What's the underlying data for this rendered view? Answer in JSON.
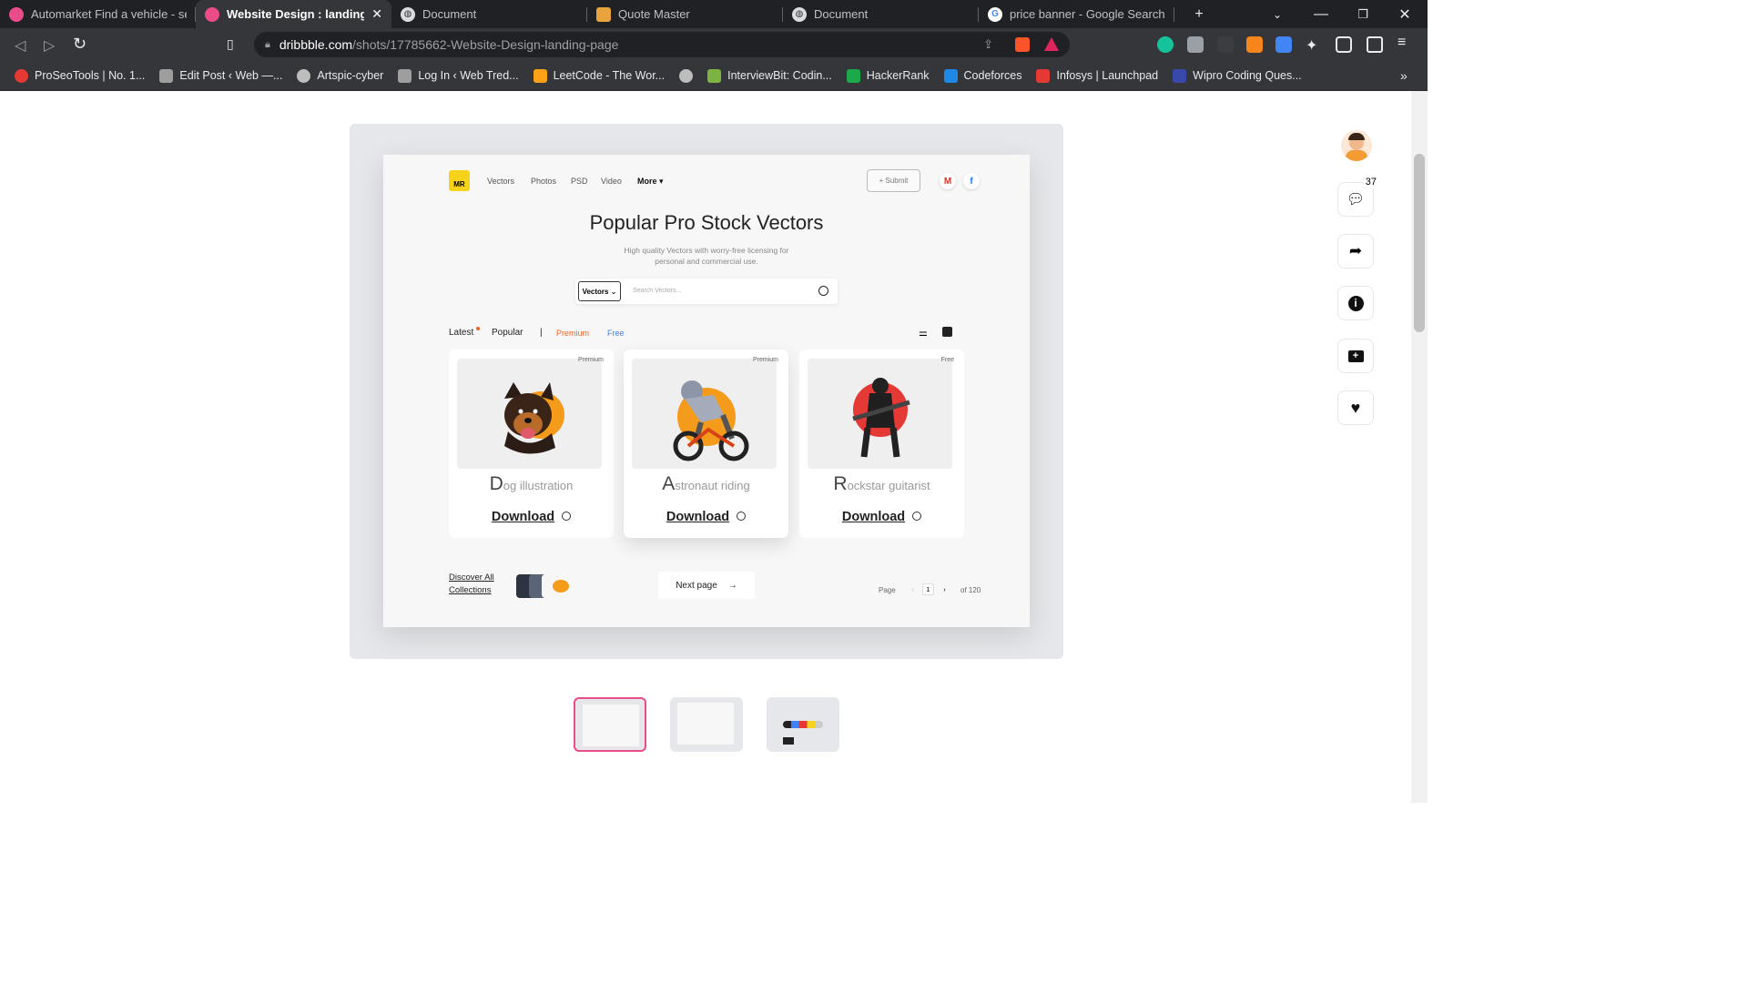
{
  "tabs": [
    {
      "title": "Automarket Find a vehicle - search",
      "favicon": "dribbble-icon",
      "color": "#ea4c89"
    },
    {
      "title": "Website Design : landing page",
      "favicon": "dribbble-icon",
      "color": "#ea4c89",
      "active": true
    },
    {
      "title": "Document",
      "favicon": "globe-icon",
      "color": "#9aa0a6"
    },
    {
      "title": "Quote Master",
      "favicon": "burger-icon",
      "color": "#e8a33d"
    },
    {
      "title": "Document",
      "favicon": "globe-icon",
      "color": "#9aa0a6"
    },
    {
      "title": "price banner - Google Search",
      "favicon": "google-icon",
      "color": "#4285f4"
    }
  ],
  "address": {
    "host": "dribbble.com",
    "path": "/shots/17785662-Website-Design-landing-page"
  },
  "bookmarks": [
    {
      "label": "ProSeoTools | No. 1...",
      "color": "#e53935"
    },
    {
      "label": "Edit Post ‹ Web —...",
      "color": "#9e9e9e"
    },
    {
      "label": "Artspic-cyber",
      "color": "#bdbdbd"
    },
    {
      "label": "Log In ‹ Web Tred...",
      "color": "#9e9e9e"
    },
    {
      "label": "LeetCode - The Wor...",
      "color": "#ffa116"
    },
    {
      "label": "",
      "color": "#bdbdbd"
    },
    {
      "label": "InterviewBit: Codin...",
      "color": "#7cb342"
    },
    {
      "label": "HackerRank",
      "color": "#1ba94c"
    },
    {
      "label": "Codeforces",
      "color": "#1e88e5"
    },
    {
      "label": "Infosys | Launchpad",
      "color": "#e53935"
    },
    {
      "label": "Wipro Coding Ques...",
      "color": "#3949ab"
    }
  ],
  "mock": {
    "logo": "MR",
    "nav": [
      "Vectors",
      "Photos",
      "PSD",
      "Video",
      "More ▾"
    ],
    "submit": "+ Submit",
    "title": "Popular Pro Stock Vectors",
    "subtitle": "High quality Vectors with worry-free licensing for personal and commercial use.",
    "search_select": "Vectors ⌄",
    "search_placeholder": "Search Vectors...",
    "filters": {
      "latest": "Latest",
      "popular": "Popular",
      "sep": "|",
      "premium": "Premium",
      "free": "Free"
    },
    "cards": [
      {
        "badge": "Premium",
        "cap": "D",
        "rest": "og illustration",
        "download": "Download"
      },
      {
        "badge": "Premium",
        "cap": "A",
        "rest": "stronaut riding",
        "download": "Download"
      },
      {
        "badge": "Free",
        "cap": "R",
        "rest": "ockstar guitarist",
        "download": "Download"
      }
    ],
    "discover": "Discover All Collections",
    "next": "Next page",
    "page_label": "Page",
    "page_current": "1",
    "page_of": "of 120"
  },
  "sidebar": {
    "comment_count": "37"
  },
  "colors": {
    "accent": "#ea4c89",
    "premium": "#f26522",
    "free": "#3b82f6",
    "logo": "#f7d21a"
  }
}
